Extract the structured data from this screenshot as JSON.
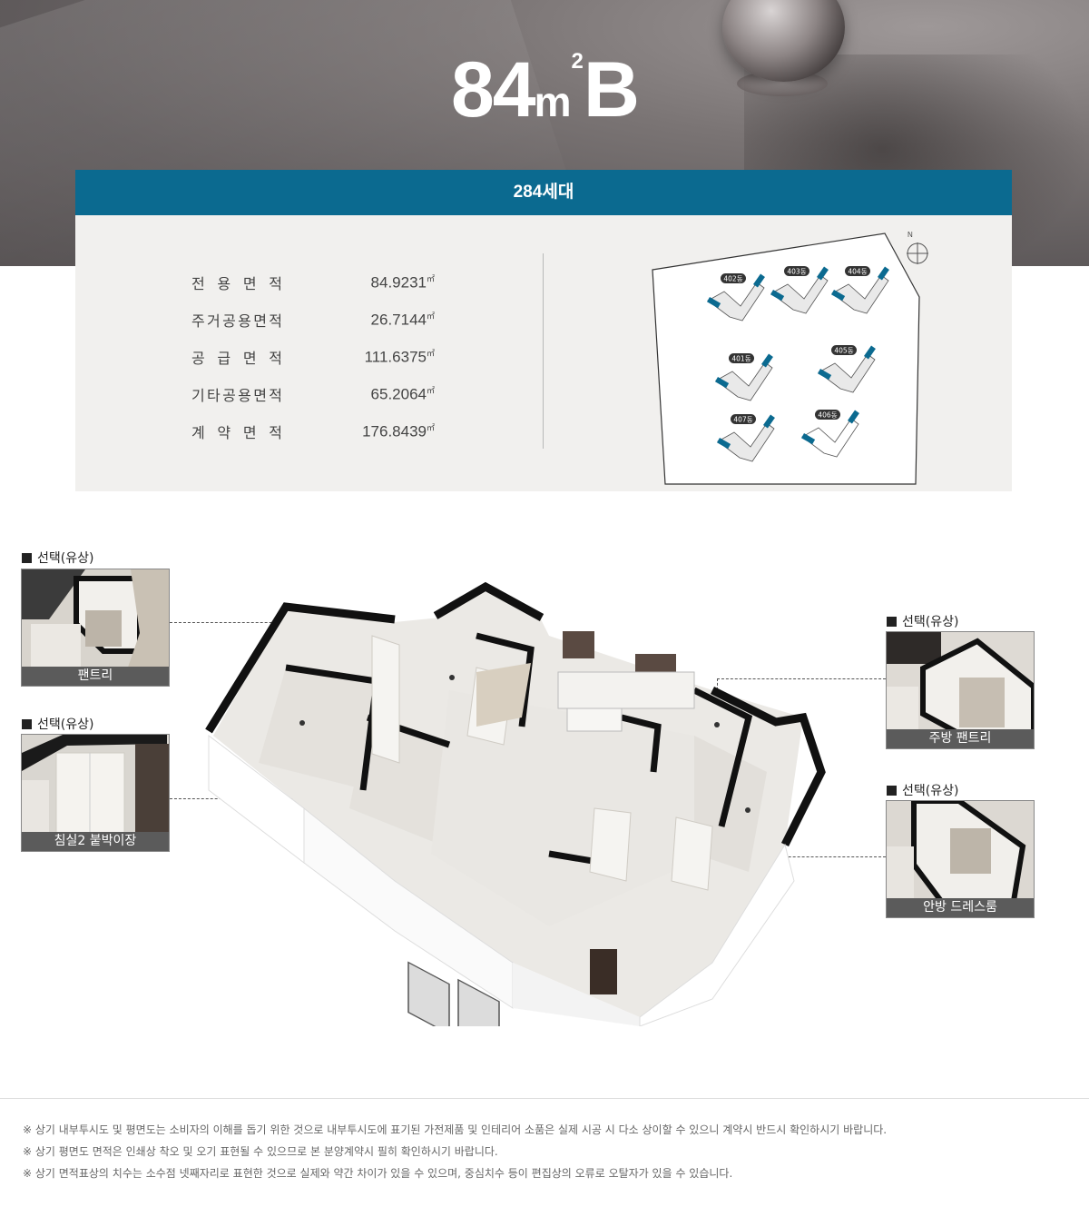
{
  "hero": {
    "size": "84",
    "unit": "m",
    "unit_sup": "2",
    "type": "B"
  },
  "info": {
    "households": "284세대",
    "areas": [
      {
        "label": [
          "전",
          "용",
          "면",
          "적"
        ],
        "value": "84.9231",
        "unit": "㎡"
      },
      {
        "label": [
          "주",
          "거",
          "공",
          "용",
          "면",
          "적"
        ],
        "value": "26.7144",
        "unit": "㎡"
      },
      {
        "label": [
          "공",
          "급",
          "면",
          "적"
        ],
        "value": "111.6375",
        "unit": "㎡"
      },
      {
        "label": [
          "기",
          "타",
          "공",
          "용",
          "면",
          "적"
        ],
        "value": "65.2064",
        "unit": "㎡"
      },
      {
        "label": [
          "계",
          "약",
          "면",
          "적"
        ],
        "value": "176.8439",
        "unit": "㎡"
      }
    ],
    "siteplan": {
      "north": "N",
      "buildings": [
        "402동",
        "403동",
        "404동",
        "401동",
        "405동",
        "407동",
        "406동"
      ]
    }
  },
  "options": [
    {
      "marker": "■",
      "label": "선택(유상)",
      "caption": "팬트리"
    },
    {
      "marker": "■",
      "label": "선택(유상)",
      "caption": "침실2 붙박이장"
    },
    {
      "marker": "■",
      "label": "선택(유상)",
      "caption": "주방 팬트리"
    },
    {
      "marker": "■",
      "label": "선택(유상)",
      "caption": "안방 드레스룸"
    }
  ],
  "notes": [
    "※ 상기 내부투시도 및 평면도는 소비자의 이해를 돕기 위한 것으로 내부투시도에 표기된 가전제품 및 인테리어 소품은 실제 시공 시 다소 상이할 수 있으니 계약시 반드시 확인하시기 바랍니다.",
    "※ 상기 평면도 면적은 인쇄상 착오 및 오기 표현될 수 있으므로 본 분양계약시 필히 확인하시기 바랍니다.",
    "※ 상기 면적표상의 치수는 소수점 넷째자리로 표현한 것으로 실제와 약간 차이가 있을 수 있으며, 중심치수 등이 편집상의 오류로 오탈자가 있을 수 있습니다."
  ],
  "colors": {
    "header": "#0b6a90",
    "box": "#f1f0ee",
    "accent_building": "#0b6a90",
    "caption_bg": "#5b5b5b"
  }
}
